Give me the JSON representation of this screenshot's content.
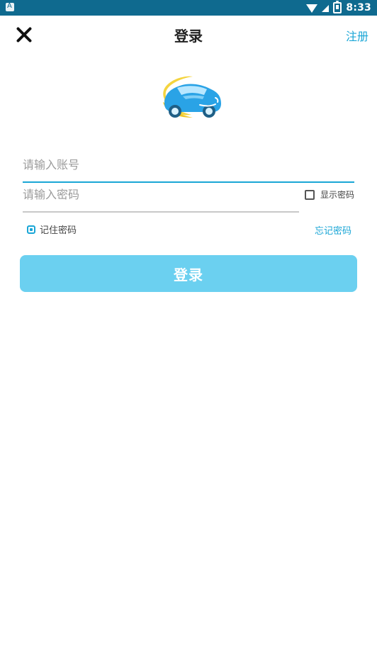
{
  "status_bar": {
    "time": "8:33"
  },
  "header": {
    "title": "登录",
    "register_label": "注册"
  },
  "form": {
    "account_placeholder": "请输入账号",
    "password_placeholder": "请输入密码",
    "show_password_label": "显示密码",
    "remember_label": "记住密码",
    "forgot_label": "忘记密码",
    "login_label": "登录"
  },
  "colors": {
    "status_bar_bg": "#0f6a8f",
    "accent": "#1aa6d6",
    "login_button_bg": "#6bd0f0"
  },
  "icons": {
    "close": "close-icon",
    "app_logo": "car-logo-icon",
    "wifi": "wifi-icon",
    "signal": "signal-icon",
    "battery": "battery-icon",
    "status_badge": "notification-icon"
  }
}
